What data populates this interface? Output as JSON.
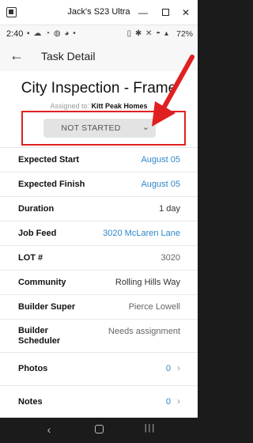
{
  "window": {
    "title": "Jack's S23 Ultra",
    "minimize_glyph": "—",
    "close_glyph": "✕"
  },
  "status_bar": {
    "time": "2:40",
    "left_icons": "▪ ☁ ◔ ◍ ◕ •",
    "right_icons": "▯ ✱ ✕ ◓ ▴",
    "battery": "72%"
  },
  "app_header": {
    "back_glyph": "←",
    "title": "Task Detail"
  },
  "task": {
    "title": "City Inspection - Frame",
    "assigned_prefix": "Assigned to:",
    "assigned_to": "Kitt Peak Homes",
    "status": "NOT STARTED",
    "chevron": "⌄"
  },
  "details": {
    "expected_start": {
      "label": "Expected Start",
      "value": "August 05"
    },
    "expected_finish": {
      "label": "Expected Finish",
      "value": "August 05"
    },
    "duration": {
      "label": "Duration",
      "value": "1 day"
    },
    "job_feed": {
      "label": "Job Feed",
      "value": "3020 McLaren Lane"
    },
    "lot": {
      "label": "LOT #",
      "value": "3020"
    },
    "community": {
      "label": "Community",
      "value": "Rolling Hills Way"
    },
    "builder_super": {
      "label": "Builder Super",
      "value": "Pierce Lowell"
    },
    "builder_scheduler": {
      "label": "Builder\nScheduler",
      "value": "Needs assignment"
    },
    "photos": {
      "label": "Photos",
      "value": "0",
      "arrow": "›"
    },
    "notes": {
      "label": "Notes",
      "value": "0",
      "arrow": "›"
    }
  },
  "nav_bar": {
    "back_glyph": "‹",
    "recent_glyph": "|||"
  },
  "colors": {
    "link_blue": "#2f86c9",
    "annotation_red": "#e02020",
    "status_pill": "#e3e3e3"
  }
}
